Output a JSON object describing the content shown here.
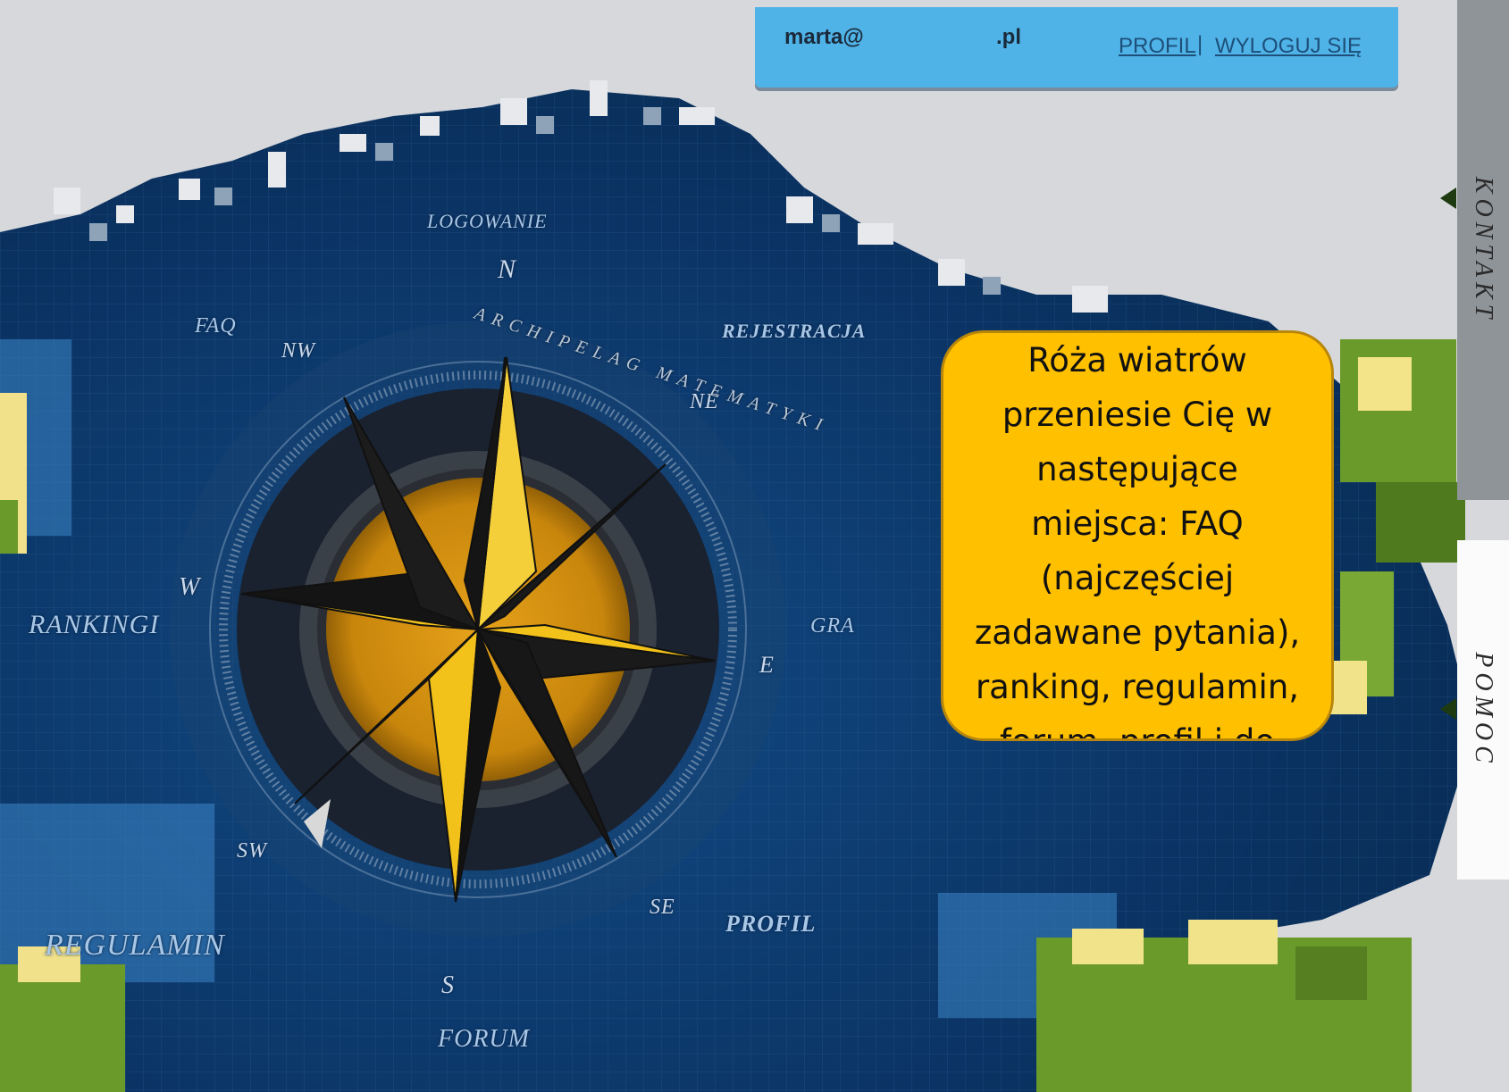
{
  "header": {
    "user_email_prefix": "marta@",
    "user_email_suffix": ".pl",
    "profile_link": "PROFIL",
    "separator": "|",
    "logout_link": "WYLOGUJ SIĘ"
  },
  "compass_nav": {
    "logowanie": "LOGOWANIE",
    "faq": "FAQ",
    "rejestracja": "REJESTRACJA",
    "rankingi": "RANKINGI",
    "gra": "GRA",
    "regulamin": "REGULAMIN",
    "profil": "PROFIL",
    "forum": "FORUM"
  },
  "compass": {
    "directions": {
      "n": "N",
      "ne": "NE",
      "e": "E",
      "se": "SE",
      "s": "S",
      "sw": "SW",
      "w": "W",
      "nw": "NW"
    },
    "ring_text": "ARCHIPELAG MATEMATYKI"
  },
  "side_tabs": {
    "kontakt": "KONTAKT",
    "pomoc": "POMOC"
  },
  "callout": {
    "text": "Róża wiatrów przeniesie Cię w następujące miejsca: FAQ (najczęściej zadawane pytania), ranking, regulamin, forum, profil i do GRY ☺"
  },
  "colors": {
    "sea": "#0d3a6e",
    "gold": "#f2c21a",
    "callout_bg": "#ffc000",
    "header_bg": "#4fb3e8"
  }
}
